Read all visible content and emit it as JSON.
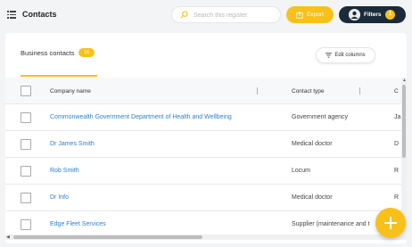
{
  "header": {
    "title": "Contacts",
    "search_placeholder": "Search this register",
    "export_label": "Export",
    "filters_label": "Filters",
    "filters_count": "1"
  },
  "card": {
    "title": "Business contacts",
    "count": "16",
    "edit_columns_label": "Edit columns"
  },
  "table": {
    "columns": [
      "Company name",
      "Contact type",
      "C"
    ],
    "rows": [
      {
        "name": "Commonwealth Government Department of Health and Wellbeing",
        "type": "Government agency",
        "extra": "Ja"
      },
      {
        "name": "Dr James Smith",
        "type": "Medical doctor",
        "extra": "D"
      },
      {
        "name": "Rob Smith",
        "type": "Locum",
        "extra": "R"
      },
      {
        "name": "Dr Info",
        "type": "Medical doctor",
        "extra": "R"
      },
      {
        "name": "Edge Fleet Services",
        "type": "Supplier (maintenance and t",
        "extra": ""
      }
    ]
  },
  "colors": {
    "accent": "#f8c11a",
    "dark": "#1c2b3a",
    "link": "#2f7fcf"
  },
  "icons": [
    "list-icon",
    "search-icon",
    "export-icon",
    "filter-avatar-icon",
    "edit-columns-icon",
    "plus-icon"
  ]
}
